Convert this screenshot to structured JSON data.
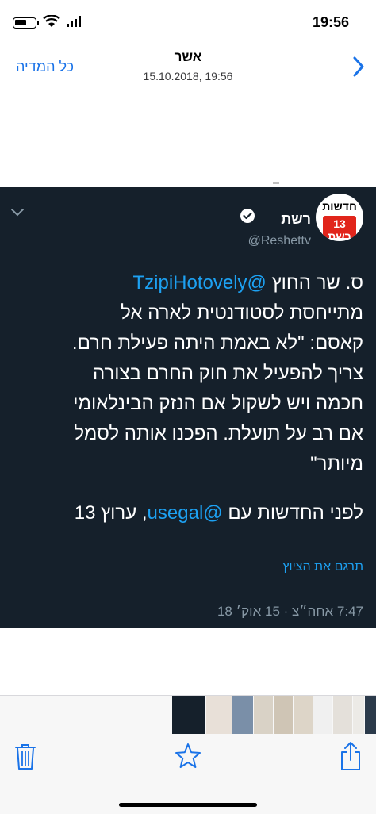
{
  "status_bar": {
    "time": "19:56",
    "battery_level": 0.6,
    "icons": [
      "battery-icon",
      "wifi-icon",
      "signal-icon"
    ]
  },
  "nav": {
    "title": "אשר",
    "subtitle": "15.10.2018, 19:56",
    "back_label": "כל המדיה",
    "forward_icon": "chevron-right-icon"
  },
  "tweet": {
    "account_name": "רשת",
    "handle": "@Reshettv",
    "avatar_text": "חדשות",
    "avatar_logo_text": "13 רשת",
    "lines": [
      {
        "pre": "ס. שר החוץ ",
        "mention": "@TzipiHotovely",
        "post": ""
      },
      {
        "pre": "מתייחסת לסטודנטית לארה אל",
        "mention": "",
        "post": ""
      },
      {
        "pre": "קאסם: \"לא באמת היתה פעילת חרם.",
        "mention": "",
        "post": ""
      },
      {
        "pre": "צריך להפעיל את חוק החרם בצורה",
        "mention": "",
        "post": ""
      },
      {
        "pre": "חכמה ויש לשקול אם הנזק הבינלאומי",
        "mention": "",
        "post": ""
      },
      {
        "pre": "אם רב על תועלת. הפכנו אותה לסמל",
        "mention": "",
        "post": ""
      },
      {
        "pre": "מיותר\"",
        "mention": "",
        "post": ""
      },
      {
        "pre": "לפני החדשות עם ",
        "mention": "@usegal",
        "post": ", ערוץ 13"
      }
    ],
    "translate_label": "תרגם את הציוץ",
    "timestamp": "7:47 אחה״צ · 15 אוק׳ 18",
    "colors": {
      "background": "#15202b",
      "text": "#ffffff",
      "link": "#1da1f2",
      "muted": "#8899a6"
    }
  },
  "toolbar": {
    "icons": [
      "trash-icon",
      "star-icon",
      "share-icon"
    ],
    "thumbnails": [
      "thumb-1",
      "thumb-2",
      "thumb-3",
      "thumb-4",
      "thumb-5",
      "thumb-6",
      "thumb-7",
      "thumb-8",
      "thumb-9",
      "thumb-10",
      "thumb-11"
    ]
  },
  "colors": {
    "accent": "#1a73e8",
    "avatar_brand": "#e1251b"
  }
}
